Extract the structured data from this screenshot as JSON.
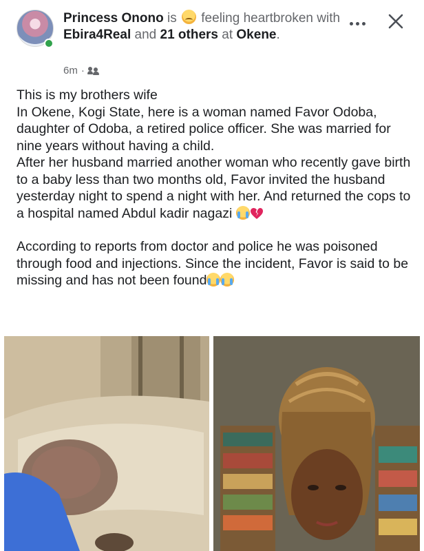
{
  "post": {
    "author": "Princess Onono",
    "is_word": "is",
    "feeling_word": "feeling",
    "feeling": "heartbroken",
    "with_word": "with",
    "tagged_user": "Ebira4Real",
    "and_word": "and",
    "others": "21 others",
    "at_word": "at",
    "location": "Okene",
    "period": ".",
    "time_ago": "6m",
    "separator": "·",
    "audience_icon": "friends-icon",
    "feeling_icon": "sad-face-emoji"
  },
  "body": {
    "p1": "This is my brothers wife\nIn Okene, Kogi State, here is a woman named Favor Odoba, daughter of Odoba, a retired police officer. She was married for nine years without having a child.\nAfter her husband married another woman who recently gave birth to a baby less than two months old, Favor invited the husband yesterday night to spend a night with her. And returned the cops to a hospital named Abdul kadir nagazi",
    "p2": "According to reports from doctor and police he was poisoned through food and injections. Since the incident, Favor is said to be missing and has not been found"
  },
  "icons": {
    "more": "more-options-icon",
    "close": "close-icon",
    "crying": "crying-face-emoji",
    "broken_heart": "broken-heart-emoji"
  },
  "colors": {
    "online": "#31a24c",
    "secondary_text": "#65676b",
    "primary_text": "#1c1e21"
  }
}
